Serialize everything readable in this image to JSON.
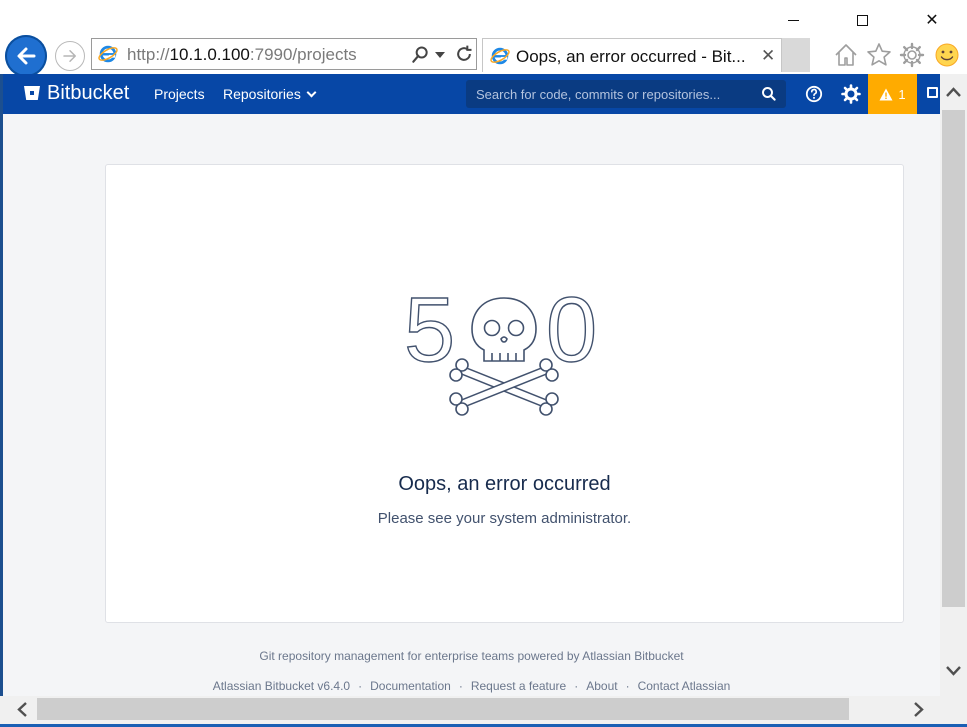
{
  "window": {
    "minimize_icon": "minimize-icon",
    "maximize_icon": "maximize-icon",
    "close_icon": "close-icon",
    "close_label": "✕"
  },
  "browser": {
    "address": {
      "prefix": "http://",
      "host": "10.1.0.100",
      "rest": ":7990/projects"
    },
    "tab": {
      "title": "Oops, an error occurred - Bit...",
      "close": "✕"
    },
    "icons": [
      "back-icon",
      "forward-icon",
      "ie-logo-icon",
      "search-icon",
      "refresh-icon",
      "home-icon",
      "star-icon",
      "gear-icon",
      "smiley-icon"
    ]
  },
  "header": {
    "brand": "Bitbucket",
    "nav": {
      "projects": "Projects",
      "repositories": "Repositories"
    },
    "search_placeholder": "Search for code, commits or repositories...",
    "alert_count": "1",
    "colors": {
      "header": "#0747a6",
      "alert": "#ffab00"
    }
  },
  "error": {
    "code_left": "5",
    "code_right": "0",
    "title": "Oops, an error occurred",
    "message": "Please see your system administrator."
  },
  "footer": {
    "tagline": "Git repository management for enterprise teams powered by Atlassian Bitbucket",
    "links": {
      "version": "Atlassian Bitbucket v6.4.0",
      "documentation": "Documentation",
      "request_feature": "Request a feature",
      "about": "About",
      "contact": "Contact Atlassian"
    },
    "separator": "·"
  }
}
